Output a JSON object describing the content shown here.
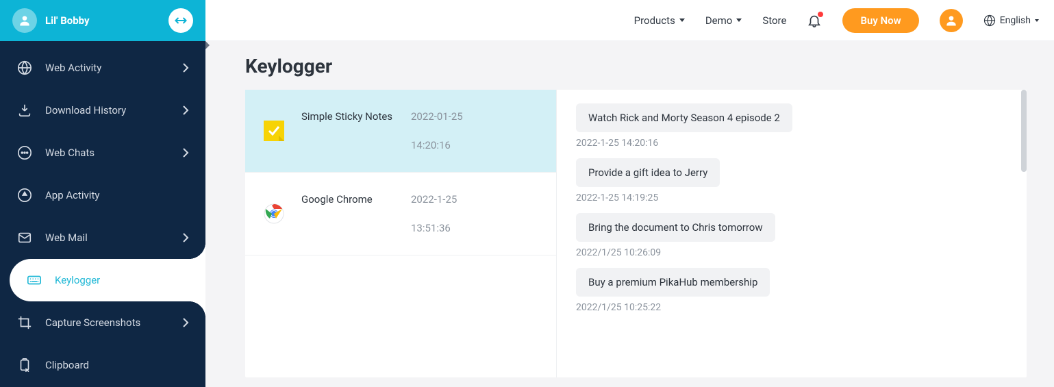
{
  "profile": {
    "name": "Lil' Bobby"
  },
  "sidebar": {
    "items": [
      {
        "label": "Web Activity",
        "has_chevron": true
      },
      {
        "label": "Download History",
        "has_chevron": true
      },
      {
        "label": "Web Chats",
        "has_chevron": true
      },
      {
        "label": "App Activity",
        "has_chevron": false
      },
      {
        "label": "Web Mail",
        "has_chevron": true
      },
      {
        "label": "Keylogger",
        "has_chevron": false
      },
      {
        "label": "Capture Screenshots",
        "has_chevron": true
      },
      {
        "label": "Clipboard",
        "has_chevron": false
      }
    ]
  },
  "topnav": {
    "products": "Products",
    "demo": "Demo",
    "store": "Store",
    "buy": "Buy Now",
    "language": "English"
  },
  "page": {
    "title": "Keylogger"
  },
  "apps": [
    {
      "name": "Simple Sticky Notes",
      "date": "2022-01-25",
      "time": "14:20:16"
    },
    {
      "name": "Google Chrome",
      "date": "2022-1-25",
      "time": "13:51:36"
    }
  ],
  "logs": [
    {
      "text": "Watch Rick and Morty Season 4 episode 2",
      "timestamp": "2022-1-25 14:20:16"
    },
    {
      "text": "Provide a gift idea to Jerry",
      "timestamp": "2022-1-25 14:19:25"
    },
    {
      "text": "Bring the document to Chris tomorrow",
      "timestamp": "2022/1/25 10:26:09"
    },
    {
      "text": "Buy a premium PikaHub membership",
      "timestamp": "2022/1/25 10:25:22"
    }
  ]
}
